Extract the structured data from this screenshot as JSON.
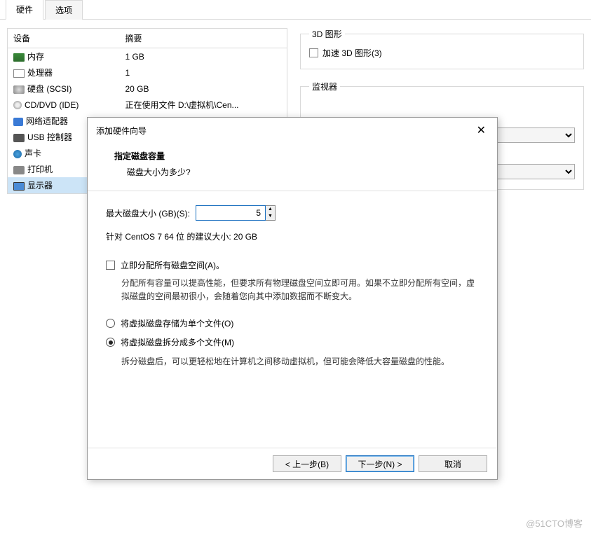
{
  "tabs": {
    "hardware": "硬件",
    "options": "选项"
  },
  "table": {
    "header_device": "设备",
    "header_summary": "摘要",
    "rows": [
      {
        "name": "内存",
        "summary": "1 GB",
        "icon": "ic-mem"
      },
      {
        "name": "处理器",
        "summary": "1",
        "icon": "ic-cpu"
      },
      {
        "name": "硬盘 (SCSI)",
        "summary": "20 GB",
        "icon": "ic-hdd"
      },
      {
        "name": "CD/DVD (IDE)",
        "summary": "正在使用文件 D:\\虚拟机\\Cen...",
        "icon": "ic-dvd"
      },
      {
        "name": "网络适配器",
        "summary": "",
        "icon": "ic-net"
      },
      {
        "name": "USB 控制器",
        "summary": "",
        "icon": "ic-usb"
      },
      {
        "name": "声卡",
        "summary": "",
        "icon": "ic-snd"
      },
      {
        "name": "打印机",
        "summary": "",
        "icon": "ic-prn"
      },
      {
        "name": "显示器",
        "summary": "",
        "icon": "ic-disp",
        "selected": true
      }
    ]
  },
  "right": {
    "group3d_title": "3D 图形",
    "group3d_checkbox": "加速 3D 图形(3)",
    "monitor_title": "监视器"
  },
  "wizard": {
    "title": "添加硬件向导",
    "heading": "指定磁盘容量",
    "sub": "磁盘大小为多少?",
    "maxsize_label": "最大磁盘大小 (GB)(S):",
    "maxsize_value": "5",
    "recommend": "针对 CentOS 7 64 位 的建议大小: 20 GB",
    "alloc_checkbox": "立即分配所有磁盘空间(A)。",
    "alloc_desc": "分配所有容量可以提高性能，但要求所有物理磁盘空间立即可用。如果不立即分配所有空间，虚拟磁盘的空间最初很小，会随着您向其中添加数据而不断变大。",
    "radio_single": "将虚拟磁盘存储为单个文件(O)",
    "radio_split": "将虚拟磁盘拆分成多个文件(M)",
    "split_desc": "拆分磁盘后，可以更轻松地在计算机之间移动虚拟机，但可能会降低大容量磁盘的性能。",
    "btn_back": "< 上一步(B)",
    "btn_next": "下一步(N) >",
    "btn_cancel": "取消"
  },
  "watermark": "@51CTO博客"
}
